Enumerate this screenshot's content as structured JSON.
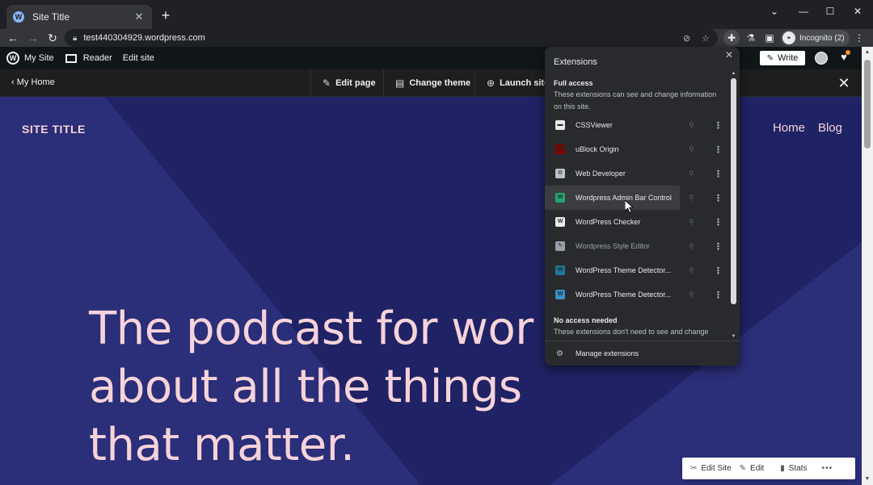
{
  "browser": {
    "tab_title": "Site Title",
    "tab_favicon": "W",
    "url": "test440304929.wordpress.com",
    "incognito_label": "Incognito (2)"
  },
  "wp_admin_bar": {
    "my_site": "My Site",
    "reader": "Reader",
    "edit_site": "Edit site",
    "write": "Write"
  },
  "editor_bar": {
    "my_home": "My Home",
    "edit_page": "Edit page",
    "change_theme": "Change theme",
    "launch_site": "Launch site"
  },
  "site": {
    "title": "SITE TITLE",
    "nav": [
      "Home",
      "Blog"
    ],
    "headline_lines": [
      "The podcast for wor",
      "about all the things",
      "that matter."
    ]
  },
  "action_bar": {
    "edit_site": "Edit Site",
    "edit": "Edit",
    "stats": "Stats",
    "more": "•••"
  },
  "extensions_popup": {
    "header": "Extensions",
    "full_access_title": "Full access",
    "full_access_desc": "These extensions can see and change information on this site.",
    "items": [
      {
        "name": "CSSViewer",
        "icon": "css-viewer-icon",
        "color": "#e8eaed",
        "muted": false
      },
      {
        "name": "uBlock Origin",
        "icon": "ublock-origin-icon",
        "color": "#800000",
        "muted": false
      },
      {
        "name": "Web Developer",
        "icon": "web-developer-icon",
        "color": "#bdc1c6",
        "muted": false
      },
      {
        "name": "Wordpress Admin Bar Control",
        "icon": "wordpress-admin-bar-icon",
        "color": "#1ea672",
        "muted": false
      },
      {
        "name": "WordPress Checker",
        "icon": "wordpress-checker-icon",
        "color": "#e8eaed",
        "muted": false
      },
      {
        "name": "Wordpress Style Editor",
        "icon": "style-editor-icon",
        "color": "#9aa0a6",
        "muted": true
      },
      {
        "name": "WordPress Theme Detector...",
        "icon": "theme-detector-icon",
        "color": "#21759b",
        "muted": false
      },
      {
        "name": "WordPress Theme Detector...",
        "icon": "theme-detector-icon",
        "color": "#3a8fc7",
        "muted": false
      }
    ],
    "no_access_title": "No access needed",
    "no_access_desc": "These extensions don't need to see and change",
    "manage": "Manage extensions"
  },
  "colors": {
    "hero_bg": "#1f2264",
    "hero_accent": "#f6d3da",
    "browser_dark": "#202124"
  }
}
